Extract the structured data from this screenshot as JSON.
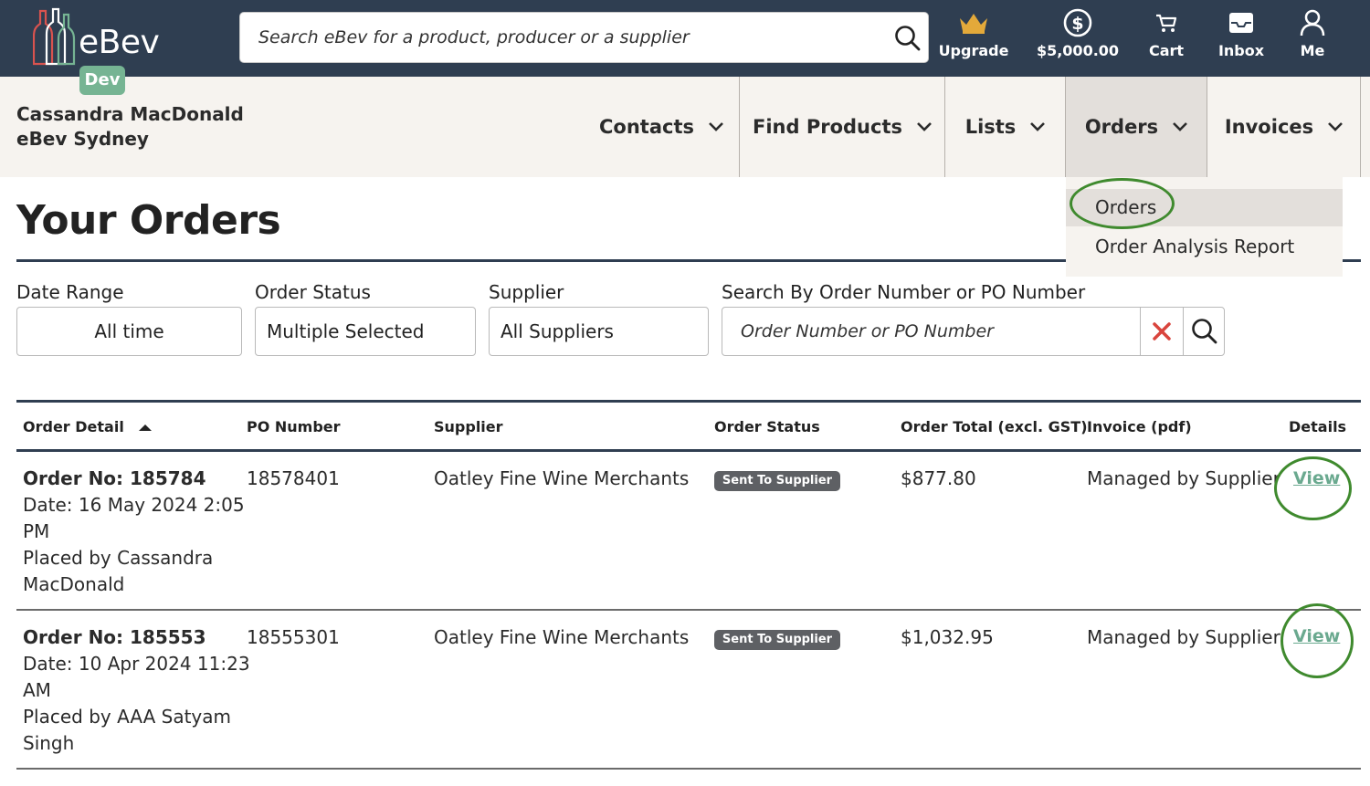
{
  "brand": {
    "name": "eBev",
    "env_badge": "Dev"
  },
  "search": {
    "placeholder": "Search eBev for a product, producer or a supplier"
  },
  "topnav": {
    "upgrade": "Upgrade",
    "balance": "$5,000.00",
    "cart": "Cart",
    "inbox": "Inbox",
    "me": "Me"
  },
  "user": {
    "name": "Cassandra MacDonald",
    "company": "eBev Sydney"
  },
  "mainnav": {
    "contacts": "Contacts",
    "find_products": "Find Products",
    "lists": "Lists",
    "orders": "Orders",
    "invoices": "Invoices",
    "active": "Orders"
  },
  "orders_dropdown": {
    "items": [
      "Orders",
      "Order Analysis Report"
    ],
    "highlighted": "Orders"
  },
  "page": {
    "title": "Your Orders"
  },
  "filters": {
    "date_range": {
      "label": "Date Range",
      "value": "All time"
    },
    "order_status": {
      "label": "Order Status",
      "value": "Multiple Selected"
    },
    "supplier": {
      "label": "Supplier",
      "value": "All Suppliers"
    },
    "order_search": {
      "label": "Search By Order Number or PO Number",
      "placeholder": "Order Number or PO Number"
    }
  },
  "table": {
    "columns": [
      "Order Detail",
      "PO Number",
      "Supplier",
      "Order Status",
      "Order Total (excl. GST)",
      "Invoice (pdf)",
      "Details"
    ],
    "sort": {
      "column": "Order Detail",
      "direction": "asc"
    },
    "rows": [
      {
        "order_no": "Order No: 185784",
        "date_l1": "Date: 16 May 2024 2:05",
        "date_l2": "PM",
        "placed_l1": "Placed by Cassandra",
        "placed_l2": "MacDonald",
        "po_number": "18578401",
        "supplier": "Oatley Fine Wine Merchants",
        "status": "Sent To Supplier",
        "total": "$877.80",
        "invoice": "Managed by Supplier",
        "details": "View"
      },
      {
        "order_no": "Order No: 185553",
        "date_l1": "Date: 10 Apr 2024 11:23",
        "date_l2": "AM",
        "placed_l1": "Placed by AAA Satyam",
        "placed_l2": "Singh",
        "po_number": "18555301",
        "supplier": "Oatley Fine Wine Merchants",
        "status": "Sent To Supplier",
        "total": "$1,032.95",
        "invoice": "Managed by Supplier",
        "details": "View"
      }
    ]
  },
  "colors": {
    "header_bg": "#2f3e51",
    "subheader_bg": "#f6f3ef",
    "active_tab_bg": "#e3dfdb",
    "dev_badge": "#76b493",
    "crown": "#e3a93a",
    "status_badge": "#5e6064",
    "link": "#6aa98f",
    "annotation": "#3f8a2e",
    "clear_x": "#d9443d"
  }
}
